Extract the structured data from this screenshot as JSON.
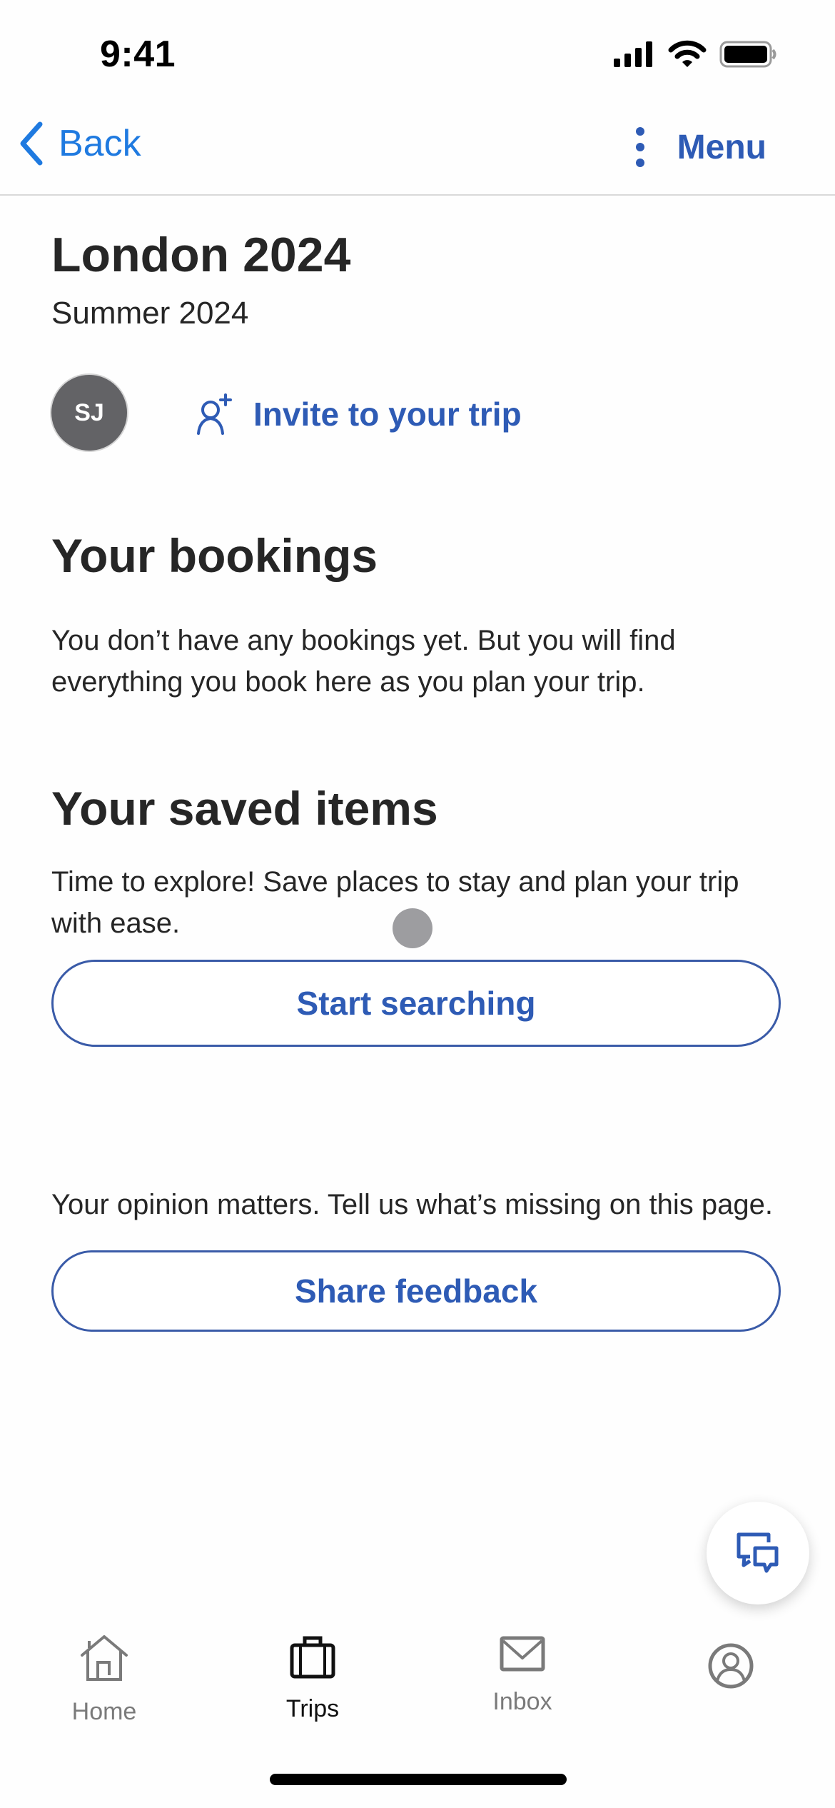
{
  "status_bar": {
    "time": "9:41",
    "icons": [
      "cellular-signal-icon",
      "wifi-icon",
      "battery-icon"
    ]
  },
  "nav": {
    "back_label": "Back",
    "menu_label": "Menu",
    "back_icon": "chevron-left-icon",
    "more_icon": "more-vertical-icon"
  },
  "trip": {
    "title": "London 2024",
    "subtitle": "Summer 2024",
    "avatar_initials": "SJ",
    "invite_label": "Invite to your trip"
  },
  "bookings": {
    "heading": "Your bookings",
    "body": "You don’t have any bookings yet. But you will find everything you book here as you plan your trip."
  },
  "saved": {
    "heading": "Your saved items",
    "body": "Time to explore! Save places to stay and plan your trip with ease.",
    "button_label": "Start searching"
  },
  "feedback": {
    "body": "Your opinion matters. Tell us what’s missing on this page.",
    "button_label": "Share feedback"
  },
  "fab": {
    "icon": "chat-bubbles-icon"
  },
  "tab_bar": {
    "tabs": [
      {
        "label": "Home",
        "icon": "home-icon",
        "active": false
      },
      {
        "label": "Trips",
        "icon": "suitcase-icon",
        "active": true
      },
      {
        "label": "Inbox",
        "icon": "envelope-icon",
        "active": false
      },
      {
        "label": "",
        "icon": "profile-icon",
        "active": false
      }
    ]
  },
  "colors": {
    "accent_blue": "#2e5bb5",
    "ios_link_blue": "#1f7ae0",
    "text_dark": "#262626",
    "avatar_gray": "#636366",
    "tab_inactive": "#7a7a7a"
  }
}
